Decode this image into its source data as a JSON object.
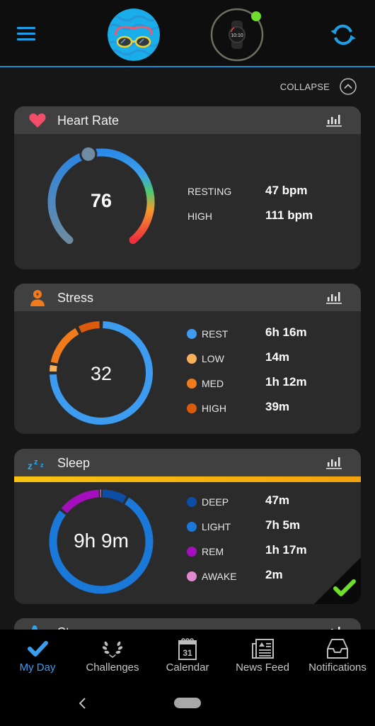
{
  "header": {
    "menu_icon": "hamburger-menu-icon",
    "avatar_icon": "swim-goggles-avatar",
    "device_icon": "smartwatch-icon",
    "device_status": "connected",
    "device_status_color": "#6ee02b",
    "sync_icon": "sync-icon",
    "accent_color": "#1ea0e6"
  },
  "collapse": {
    "label": "COLLAPSE",
    "icon": "chevron-up-circle-icon"
  },
  "cards": {
    "heart_rate": {
      "title": "Heart Rate",
      "icon": "heart-icon",
      "current_value": "76",
      "stats": [
        {
          "label": "RESTING",
          "value": "47 bpm"
        },
        {
          "label": "HIGH",
          "value": "111 bpm"
        }
      ]
    },
    "stress": {
      "title": "Stress",
      "icon": "stress-person-icon",
      "score": "32",
      "stats": [
        {
          "label": "REST",
          "value": "6h 16m",
          "color": "#3d9bf0",
          "minutes": 376
        },
        {
          "label": "LOW",
          "value": "14m",
          "color": "#f8b05a",
          "minutes": 14
        },
        {
          "label": "MED",
          "value": "1h 12m",
          "color": "#f07a1c",
          "minutes": 72
        },
        {
          "label": "HIGH",
          "value": "39m",
          "color": "#dc5a0c",
          "minutes": 39
        }
      ]
    },
    "sleep": {
      "title": "Sleep",
      "icon": "zzz-sleep-icon",
      "total": "9h 9m",
      "stats": [
        {
          "label": "DEEP",
          "value": "47m",
          "color": "#0c4ea6",
          "minutes": 47
        },
        {
          "label": "LIGHT",
          "value": "7h 5m",
          "color": "#1a78d8",
          "minutes": 425
        },
        {
          "label": "REM",
          "value": "1h 17m",
          "color": "#a40fbd",
          "minutes": 77
        },
        {
          "label": "AWAKE",
          "value": "2m",
          "color": "#e08ad0",
          "minutes": 2
        }
      ],
      "status_icon": "checkmark-icon"
    },
    "partial": {
      "title": "St",
      "icon": "steps-icon"
    }
  },
  "bottom_nav": {
    "items": [
      {
        "label": "My Day",
        "icon": "checkmark-icon",
        "active": true
      },
      {
        "label": "Challenges",
        "icon": "laurel-wreath-icon",
        "active": false
      },
      {
        "label": "Calendar",
        "icon": "calendar-icon",
        "calendar_day": "31",
        "active": false
      },
      {
        "label": "News Feed",
        "icon": "newspaper-icon",
        "active": false
      },
      {
        "label": "Notifications",
        "icon": "inbox-tray-icon",
        "active": false
      }
    ]
  },
  "system_nav": {
    "back_icon": "back-chevron-icon",
    "home_icon": "home-pill-icon"
  }
}
